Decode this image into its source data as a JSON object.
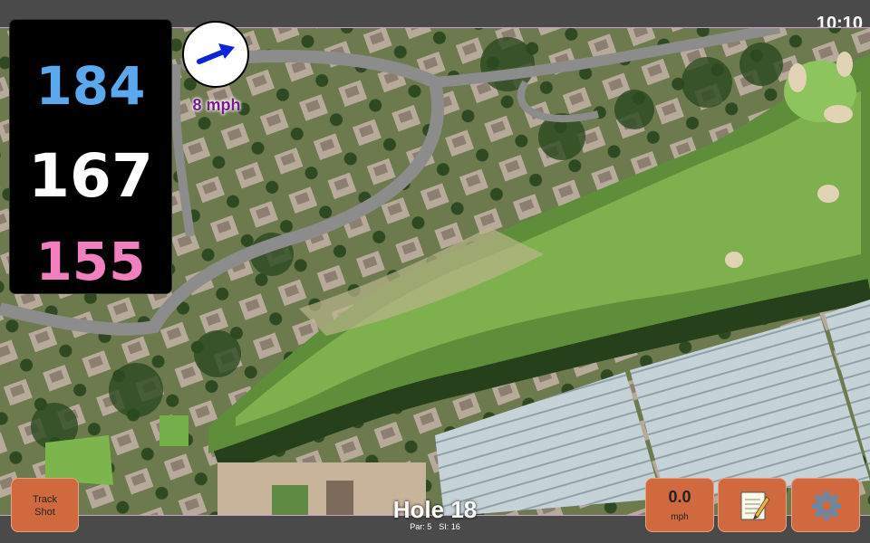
{
  "status_bar": {
    "time": "10:10"
  },
  "distances": {
    "back": "184",
    "middle": "167",
    "front": "155",
    "colors": {
      "back": "#5aa9ef",
      "middle": "#ffffff",
      "front": "#f27fc0"
    }
  },
  "wind": {
    "speed_label": "8 mph",
    "direction_icon": "arrow-right-icon"
  },
  "hole": {
    "title": "Hole 18",
    "par_label": "Par: 5",
    "si_label": "SI: 16"
  },
  "buttons": {
    "track_shot": {
      "line1": "Track",
      "line2": "Shot"
    },
    "speed": {
      "value": "0.0",
      "unit": "mph"
    },
    "notes_icon": "notepad-icon",
    "settings_icon": "gear-icon"
  },
  "colors": {
    "accent": "#d06a3e",
    "wind_text": "#7a1b8c",
    "bar": "#4a4a4a"
  }
}
